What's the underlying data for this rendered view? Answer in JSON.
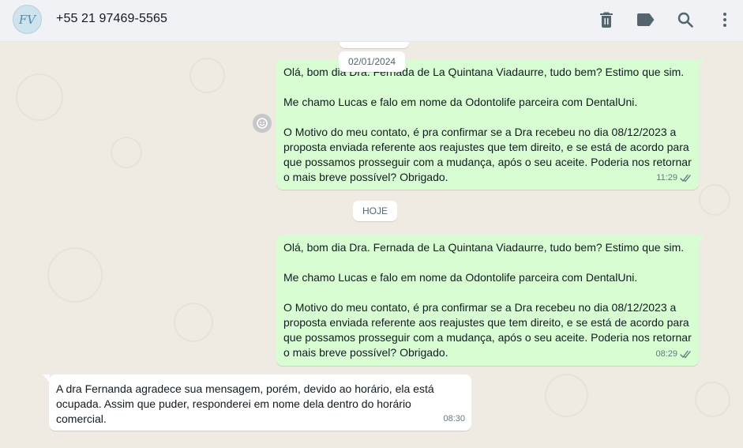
{
  "header": {
    "avatar_initials": "FV",
    "contact_name": "+55 21 97469-5565",
    "icons": [
      "delete-icon",
      "label-icon",
      "search-icon",
      "menu-icon"
    ]
  },
  "chat": {
    "top_pill": "",
    "date_sticky": "02/01/2024",
    "date_today": "HOJE",
    "messages": [
      {
        "direction": "outgoing",
        "text": "Olá, bom dia Dra. Fernada de La Quintana Viadaurre, tudo bem? Estimo que sim.\n\nMe chamo Lucas e falo em nome da Odontolife parceira com DentalUni.\n\nO Motivo do meu contato, é pra confirmar se a Dra recebeu no dia 08/12/2023 a proposta enviada referente aos reajustes que tem direito, e se está de acordo para que possamos prosseguir com a mudança, após o seu aceite. Poderia nos retornar o mais breve possível? Obrigado.",
        "time": "11:29",
        "status": "delivered"
      },
      {
        "direction": "outgoing",
        "text": "Olá, bom dia Dra. Fernada de La Quintana Viadaurre, tudo bem? Estimo que sim.\n\nMe chamo Lucas e falo em nome da Odontolife parceira com DentalUni.\n\nO Motivo do meu contato, é pra confirmar se a Dra recebeu no dia 08/12/2023 a proposta enviada referente aos reajustes que tem direito, e se está de acordo para que possamos prosseguir com a mudança, após o seu aceite. Poderia nos retornar o mais breve possível? Obrigado.",
        "time": "08:29",
        "status": "delivered"
      },
      {
        "direction": "incoming",
        "text": "A dra Fernanda agradece sua mensagem, porém, devido ao horário, ela está ocupada. Assim que puder, responderei em nome dela dentro do horário comercial.",
        "time": "08:30"
      }
    ]
  },
  "colors": {
    "outgoing_bubble": "#d9fdd3",
    "incoming_bubble": "#ffffff",
    "chat_background": "#efeae2",
    "header_background": "#f0f2f5",
    "tick_color": "#667781"
  }
}
